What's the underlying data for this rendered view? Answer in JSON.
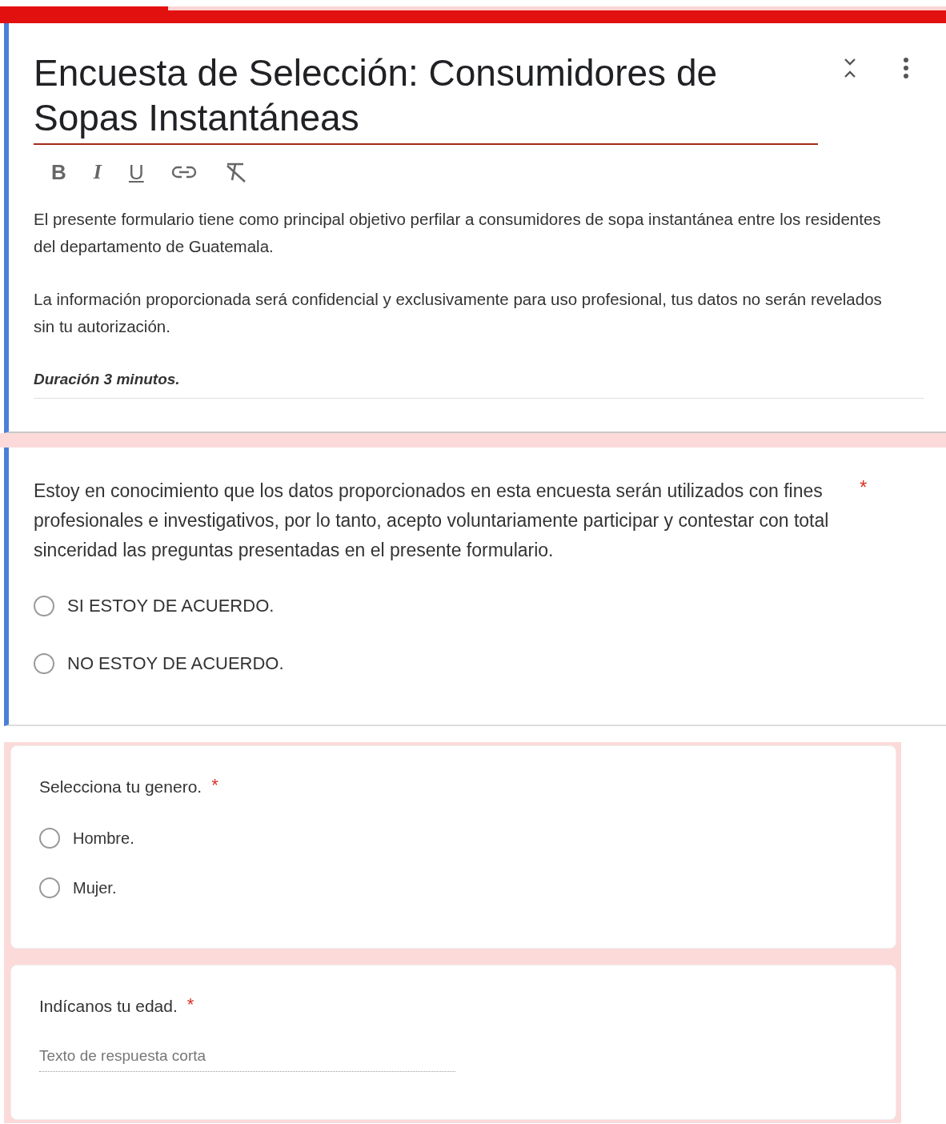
{
  "header": {
    "title": "Encuesta de Selección: Consumidores de Sopas Instantáneas",
    "focused": true,
    "toolbar": [
      {
        "kind": "bold",
        "label": "B"
      },
      {
        "kind": "italic",
        "label": "I"
      },
      {
        "kind": "underline",
        "label": "U"
      },
      {
        "kind": "link"
      },
      {
        "kind": "clear-format"
      }
    ],
    "paragraphs": [
      {
        "text": "El presente formulario tiene como principal objetivo perfilar a consumidores de sopa instantánea entre los residentes del departamento de Guatemala.",
        "emphasis": false
      },
      {
        "text": "La información proporcionada será confidencial y exclusivamente para uso profesional, tus datos no serán revelados sin tu autorización.",
        "emphasis": false
      },
      {
        "text": "Duración 3 minutos.",
        "emphasis": true
      }
    ]
  },
  "questions": [
    {
      "kind": "radio",
      "focused": true,
      "required_mark": "*",
      "text": "Estoy en conocimiento que los datos proporcionados en esta encuesta serán utilizados con fines profesionales e investigativos, por lo tanto, acepto voluntariamente participar y contestar con total sinceridad las preguntas presentadas en el presente formulario.",
      "options": [
        {
          "label": "SI ESTOY DE ACUERDO.",
          "selected": false
        },
        {
          "label": "NO ESTOY DE ACUERDO.",
          "selected": false
        }
      ]
    },
    {
      "kind": "radio",
      "focused": false,
      "required_mark": "*",
      "text": "Selecciona tu genero.",
      "options": [
        {
          "label": "Hombre.",
          "selected": false
        },
        {
          "label": "Mujer.",
          "selected": false
        }
      ]
    },
    {
      "kind": "short-text",
      "focused": false,
      "required_mark": "*",
      "text": "Indícanos tu edad.",
      "placeholder": "Texto de respuesta corta"
    }
  ]
}
